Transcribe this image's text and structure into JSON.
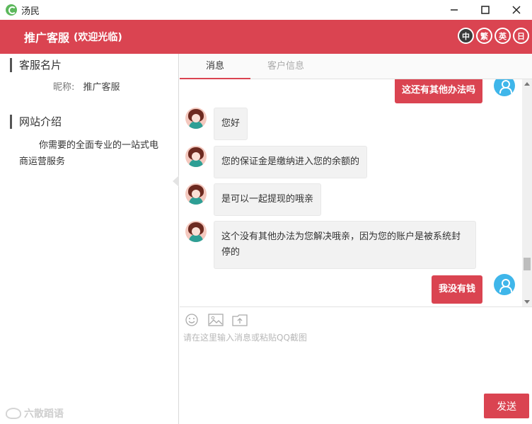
{
  "window": {
    "title": "汤民"
  },
  "header": {
    "title": "推广客服",
    "subtitle": "(欢迎光临)",
    "languages": [
      "中",
      "繁",
      "英",
      "日"
    ],
    "active_language": "中"
  },
  "sidebar": {
    "card_heading": "客服名片",
    "nickname_label": "昵称:",
    "nickname_value": "推广客服",
    "intro_heading": "网站介绍",
    "intro_text": "你需要的全面专业的一站式电商运营服务"
  },
  "tabs": [
    {
      "label": "消息",
      "active": true
    },
    {
      "label": "客户信息",
      "active": false
    }
  ],
  "messages": [
    {
      "from": "user",
      "text": "这还有其他办法吗"
    },
    {
      "from": "agent",
      "text": "您好"
    },
    {
      "from": "agent",
      "text": "您的保证金是缴纳进入您的余额的"
    },
    {
      "from": "agent",
      "text": "是可以一起提现的哦亲"
    },
    {
      "from": "agent",
      "text": "这个没有其他办法为您解决哦亲，因为您的账户是被系统封停的"
    },
    {
      "from": "user",
      "text": "我没有钱"
    }
  ],
  "composer": {
    "placeholder": "请在这里输入消息或粘贴QQ截图",
    "send_label": "发送",
    "tools": [
      "emoji-icon",
      "image-icon",
      "upload-file-icon"
    ]
  },
  "watermark": {
    "text": "六散蹈语"
  },
  "colors": {
    "accent": "#da4451",
    "user_avatar": "#3fb6ea"
  }
}
